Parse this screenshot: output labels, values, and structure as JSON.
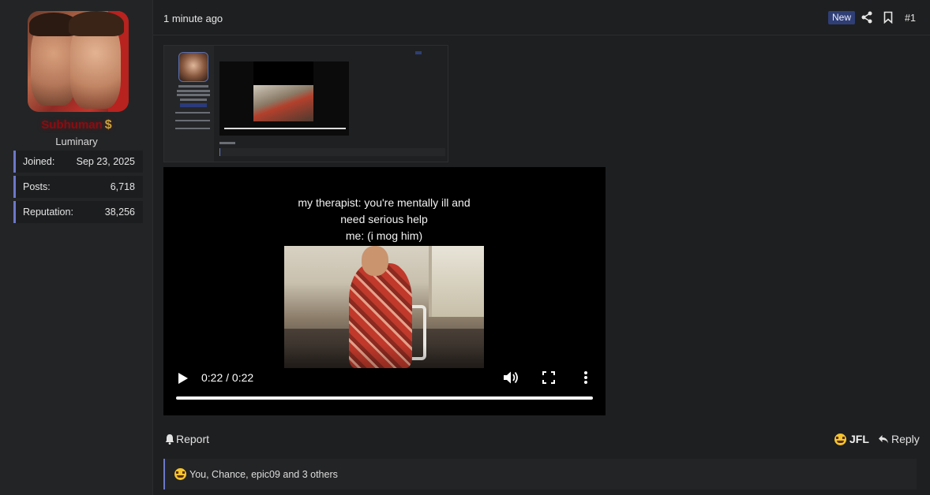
{
  "user": {
    "username": "Subhuman",
    "badge_symbol": "$",
    "user_title": "Luminary",
    "stats": [
      {
        "label": "Joined:",
        "value": "Sep 23, 2025"
      },
      {
        "label": "Posts:",
        "value": "6,718"
      },
      {
        "label": "Reputation:",
        "value": "38,256"
      }
    ]
  },
  "post": {
    "timestamp": "1 minute ago",
    "new_badge": "New",
    "post_number": "#1"
  },
  "video": {
    "caption_line1": "my therapist: you're mentally ill and",
    "caption_line2": "need serious help",
    "caption_line3": "me: (i mog him)",
    "time": "0:22 / 0:22",
    "progress": 1.0
  },
  "actions": {
    "report": "Report",
    "jfl": "JFL",
    "reply": "Reply"
  },
  "reactions": {
    "text": "You, Chance, epic09 and 3 others"
  },
  "colors": {
    "accent": "#6b78c9",
    "username": "#8a0d12",
    "badge": "#2f3e74"
  }
}
